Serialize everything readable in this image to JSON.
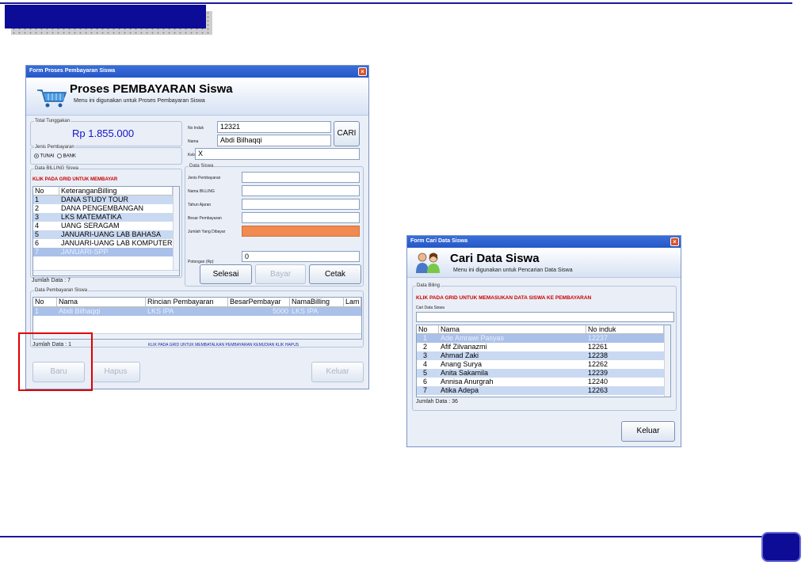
{
  "payment_form": {
    "window_title": "Form Proses Pembayaran Siswa",
    "close_glyph": "×",
    "header_title": "Proses PEMBAYARAN Siswa",
    "header_subtitle": "Menu ini digunakan untuk Proses Pembayaran Siswa",
    "total_tunggakan": {
      "label": "Total Tunggakan",
      "value": "Rp  1.855.000"
    },
    "student": {
      "no_induk_label": "No Induk",
      "no_induk": "12321",
      "nama_label": "Nama",
      "nama": "Abdi Bilhaqqi",
      "kelas_label": "Kelas",
      "kelas": "X",
      "cari_button": "CARI"
    },
    "jenis_pembayaran": {
      "label": "Jenis Pembayaran",
      "tunai": "TUNAI",
      "bank": "BANK"
    },
    "billing": {
      "group_label": "Data BILLING Siswa",
      "instruction": "KLIK PADA GRID UNTUK MEMBAYAR",
      "columns": [
        "No",
        "KeteranganBilling"
      ],
      "rows": [
        {
          "no": "1",
          "keterangan": "DANA STUDY TOUR"
        },
        {
          "no": "2",
          "keterangan": "DANA PENGEMBANGAN"
        },
        {
          "no": "3",
          "keterangan": "LKS MATEMATIKA"
        },
        {
          "no": "4",
          "keterangan": "UANG SERAGAM"
        },
        {
          "no": "5",
          "keterangan": "JANUARI-UANG LAB BAHASA"
        },
        {
          "no": "6",
          "keterangan": "JANUARI-UANG LAB KOMPUTER"
        },
        {
          "no": "7",
          "keterangan": "JANUARI-SPP"
        }
      ],
      "jumlah": "Jumlah Data : 7"
    },
    "data_siswa": {
      "group_label": "Data Siswa",
      "jenis_label": "Jenis Pembayaran",
      "nama_billing_label": "Nama BILLING",
      "tahun_label": "Tahun Ajaran",
      "besar_label": "Besar Pembayaran",
      "jumlah_dibayar_label": "Jumlah Yang Dibayar",
      "potongan_label": "Potongan (Rp)",
      "potongan_value": "0",
      "selesai_button": "Selesai",
      "bayar_button": "Bayar",
      "cetak_button": "Cetak"
    },
    "pembayaran": {
      "group_label": "Data Pembayaran Siswa",
      "columns": [
        "No",
        "Nama",
        "Rincian Pembayaran",
        "BesarPembayar",
        "NamaBilling",
        "Lam"
      ],
      "rows": [
        {
          "no": "1",
          "nama": "Abdi Bilhaqqi",
          "rincian": "LKS IPA",
          "besar": "5000",
          "billing": "LKS IPA"
        }
      ],
      "jumlah": "Jumlah Data : 1",
      "instruction": "KLIK PADA GRID UNTUK MEMBATALKAN PEMBAYARAN KEMUDIAN KLIK HAPUS"
    },
    "footer": {
      "baru": "Baru",
      "hapus": "Hapus",
      "keluar": "Keluar"
    }
  },
  "search_form": {
    "window_title": "Form Cari Data Siswa",
    "close_glyph": "×",
    "header_title": "Cari Data Siswa",
    "header_subtitle": "Menu ini digunakan untuk Pencarian Data Siswa",
    "group_label": "Data Biling",
    "instruction": "KLIK  PADA GRID UNTUK MEMASUKAN DATA SISWA KE PEMBAYARAN",
    "search_label": "Cari Data Siswa",
    "search_value": "",
    "columns": [
      "No",
      "Nama",
      "No induk"
    ],
    "rows": [
      {
        "no": "1",
        "nama": "Ade Amrawi Pasyas",
        "induk": "12237"
      },
      {
        "no": "2",
        "nama": "Afif Zilvanazmi",
        "induk": "12261"
      },
      {
        "no": "3",
        "nama": "Ahmad Zaki",
        "induk": "12238"
      },
      {
        "no": "4",
        "nama": "Anang Surya",
        "induk": "12262"
      },
      {
        "no": "5",
        "nama": "Anita Sakamila",
        "induk": "12239"
      },
      {
        "no": "6",
        "nama": "Annisa Anurgrah",
        "induk": "12240"
      },
      {
        "no": "7",
        "nama": "Atika Adepa",
        "induk": "12263"
      }
    ],
    "jumlah": "Jumlah Data : 36",
    "keluar": "Keluar"
  },
  "colors": {
    "slide_accent": "#0c0c96",
    "highlight_box": "#e00000",
    "amount_field": "#f08a50",
    "amount_text": "#1414c8"
  }
}
